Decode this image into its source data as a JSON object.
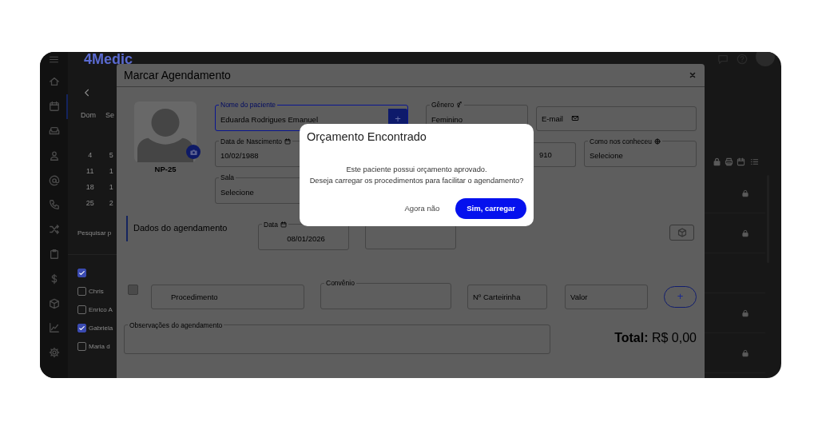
{
  "app": {
    "logo": "4Medic",
    "nav": [
      {
        "selected": false
      },
      {
        "selected": true
      },
      {
        "selected": false
      },
      {
        "selected": false
      },
      {
        "selected": false
      },
      {
        "selected": false
      },
      {
        "selected": false
      },
      {
        "selected": false
      },
      {
        "selected": false
      },
      {
        "selected": false
      },
      {
        "selected": false
      },
      {
        "selected": false
      }
    ],
    "calendar": {
      "weekdays": [
        "Dom",
        "Se"
      ],
      "weeks": [
        [
          "4",
          "5"
        ],
        [
          "11",
          "1"
        ],
        [
          "18",
          "1"
        ],
        [
          "25",
          "2"
        ]
      ]
    },
    "search": {
      "placeholder": "Pesquisar p"
    },
    "professionals": [
      {
        "checked": true
      },
      {
        "name": "Chris",
        "checked": false
      },
      {
        "name": "Enrico A",
        "checked": false
      },
      {
        "name": "Gabriela",
        "checked": true
      },
      {
        "name": "Maria d",
        "checked": false
      }
    ],
    "schedule_rows": [
      {
        "locked": true
      },
      {
        "locked": true
      },
      {
        "locked": false
      },
      {
        "locked": true
      },
      {
        "locked": true
      }
    ]
  },
  "modal": {
    "title": "Marcar Agendamento",
    "patient_code": "NP-25",
    "name_field": {
      "label": "Nome do paciente",
      "value": "Eduarda Rodrigues Emanuel",
      "focused": true,
      "add": "+"
    },
    "gender_field": {
      "label": "Gênero",
      "value": "Feminino"
    },
    "email_field": {
      "placeholder": "E-mail"
    },
    "birth_field": {
      "label": "Data de Nascimento",
      "value": "10/02/1988"
    },
    "phone_field": {
      "value": "910"
    },
    "source_field": {
      "label": "Como nos conheceu",
      "value": "Selecione"
    },
    "room_field": {
      "label": "Sala",
      "value": "Selecione"
    },
    "section_title": "Dados do agendamento",
    "date_field": {
      "label": "Data",
      "value": "08/01/2026"
    },
    "procedure": {
      "checked": false,
      "placeholder": "Procedimento"
    },
    "insurance_field": {
      "label": "Convênio"
    },
    "card_field": {
      "placeholder": "Nº Carteirinha"
    },
    "value_field": {
      "placeholder": "Valor"
    },
    "add_button": "+",
    "notes_field": {
      "label": "Observações do agendamento"
    },
    "total": "**Total:** R$ 0,00"
  },
  "dialog": {
    "title": "Orçamento Encontrado",
    "message": [
      "Este paciente possui orçamento aprovado.",
      "Deseja carregar os procedimentos para facilitar o agendamento?"
    ],
    "buttons": [
      {
        "label": "Agora não",
        "kind": "link"
      },
      {
        "label": "Sim, carregar",
        "kind": "primary"
      }
    ]
  }
}
